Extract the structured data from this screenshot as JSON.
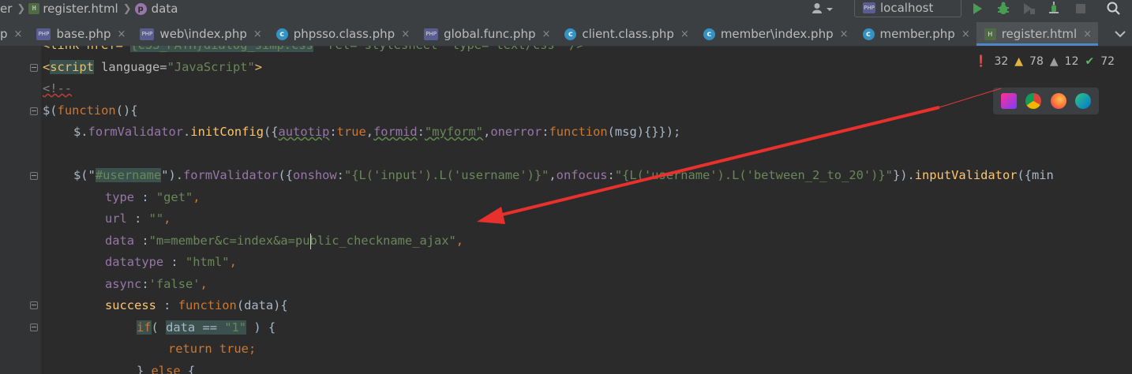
{
  "breadcrumb": {
    "items": [
      "er",
      "register.html",
      "data"
    ]
  },
  "toolbar": {
    "user_icon": "user-icon",
    "run_config": "localhost",
    "run_icon": "run-icon",
    "debug_icon": "debug-icon",
    "search_icon": "search-icon"
  },
  "tabs": [
    {
      "label": "p",
      "icon": "php-file",
      "close": "×"
    },
    {
      "label": "base.php",
      "icon": "php-file",
      "close": "×"
    },
    {
      "label": "web\\index.php",
      "icon": "php-file",
      "close": "×"
    },
    {
      "label": "phpsso.class.php",
      "icon": "php-class",
      "close": "×"
    },
    {
      "label": "global.func.php",
      "icon": "php-file",
      "close": "×"
    },
    {
      "label": "client.class.php",
      "icon": "php-class",
      "close": "×"
    },
    {
      "label": "member\\index.php",
      "icon": "php-class",
      "close": "×"
    },
    {
      "label": "member.php",
      "icon": "php-class",
      "close": "×"
    },
    {
      "label": "register.html",
      "icon": "html-file",
      "close": "×",
      "active": true
    }
  ],
  "inspections": {
    "errors": "32",
    "warnings": "78",
    "weak_warnings": "12",
    "typos": "72"
  },
  "browsers": [
    "phpstorm-icon",
    "chrome-icon",
    "firefox-icon",
    "edge-icon"
  ],
  "code": {
    "l0": {
      "p1": "<link href=\"",
      "p2": "{CSS_PATH}dialog_simp.css",
      "p3": "\" rel=\"stylesheet\" type=\"text/css\" />"
    },
    "l1": {
      "p1": "<",
      "p2": "script",
      "p3": " language=",
      "p4": "\"JavaScript\"",
      "p5": ">"
    },
    "l2": {
      "p1": "<!--"
    },
    "l3": {
      "p1": "$(",
      "p2": "function",
      "p3": "(){"
    },
    "l4": {
      "p1": "$.",
      "p2": "formValidator",
      "p3": ".",
      "p4": "initConfig",
      "p5": "({",
      "p6": "autotip",
      "p7": ":",
      "p8": "true",
      "p9": ",",
      "p10": "formid",
      "p11": ":",
      "p12": "\"myform\"",
      "p13": ",",
      "p14": "onerror",
      "p15": ":",
      "p16": "function",
      "p17": "(msg){}});"
    },
    "l5": {
      "p1": "$(\"",
      "p2": "#username",
      "p3": "\").",
      "p4": "formValidator",
      "p5": "({",
      "p6": "onshow",
      "p7": ":",
      "p8": "\"{L('input').L('username')}\"",
      "p9": ",",
      "p10": "onfocus",
      "p11": ":",
      "p12": "\"{L('username').L('between_2_to_20')}\"",
      "p13": "}).",
      "p14": "inputValidator",
      "p15": "({min"
    },
    "l6": {
      "p1": "type",
      "p2": " : ",
      "p3": "\"get\"",
      "p4": ","
    },
    "l7": {
      "p1": "url",
      "p2": " : ",
      "p3": "\"\"",
      "p4": ","
    },
    "l8": {
      "p1": "data",
      "p2": " :",
      "p3": "\"m=member&c=index&a=public_checkname_ajax\"",
      "p4": ","
    },
    "l9": {
      "p1": "datatype",
      "p2": " : ",
      "p3": "\"html\"",
      "p4": ","
    },
    "l10": {
      "p1": "async",
      "p2": ":",
      "p3": "'false'",
      "p4": ","
    },
    "l11": {
      "p1": "success",
      "p2": " : ",
      "p3": "function",
      "p4": "(data){"
    },
    "l12": {
      "p1": "if",
      "p2": "( ",
      "p3": "data",
      "p4": " == ",
      "p5": "\"1\"",
      "p6": " ) {"
    },
    "l13": {
      "p1": "return ",
      "p2": "true",
      "p3": ";"
    },
    "l14": {
      "p1": "} ",
      "p2": "else",
      "p3": " {"
    }
  }
}
